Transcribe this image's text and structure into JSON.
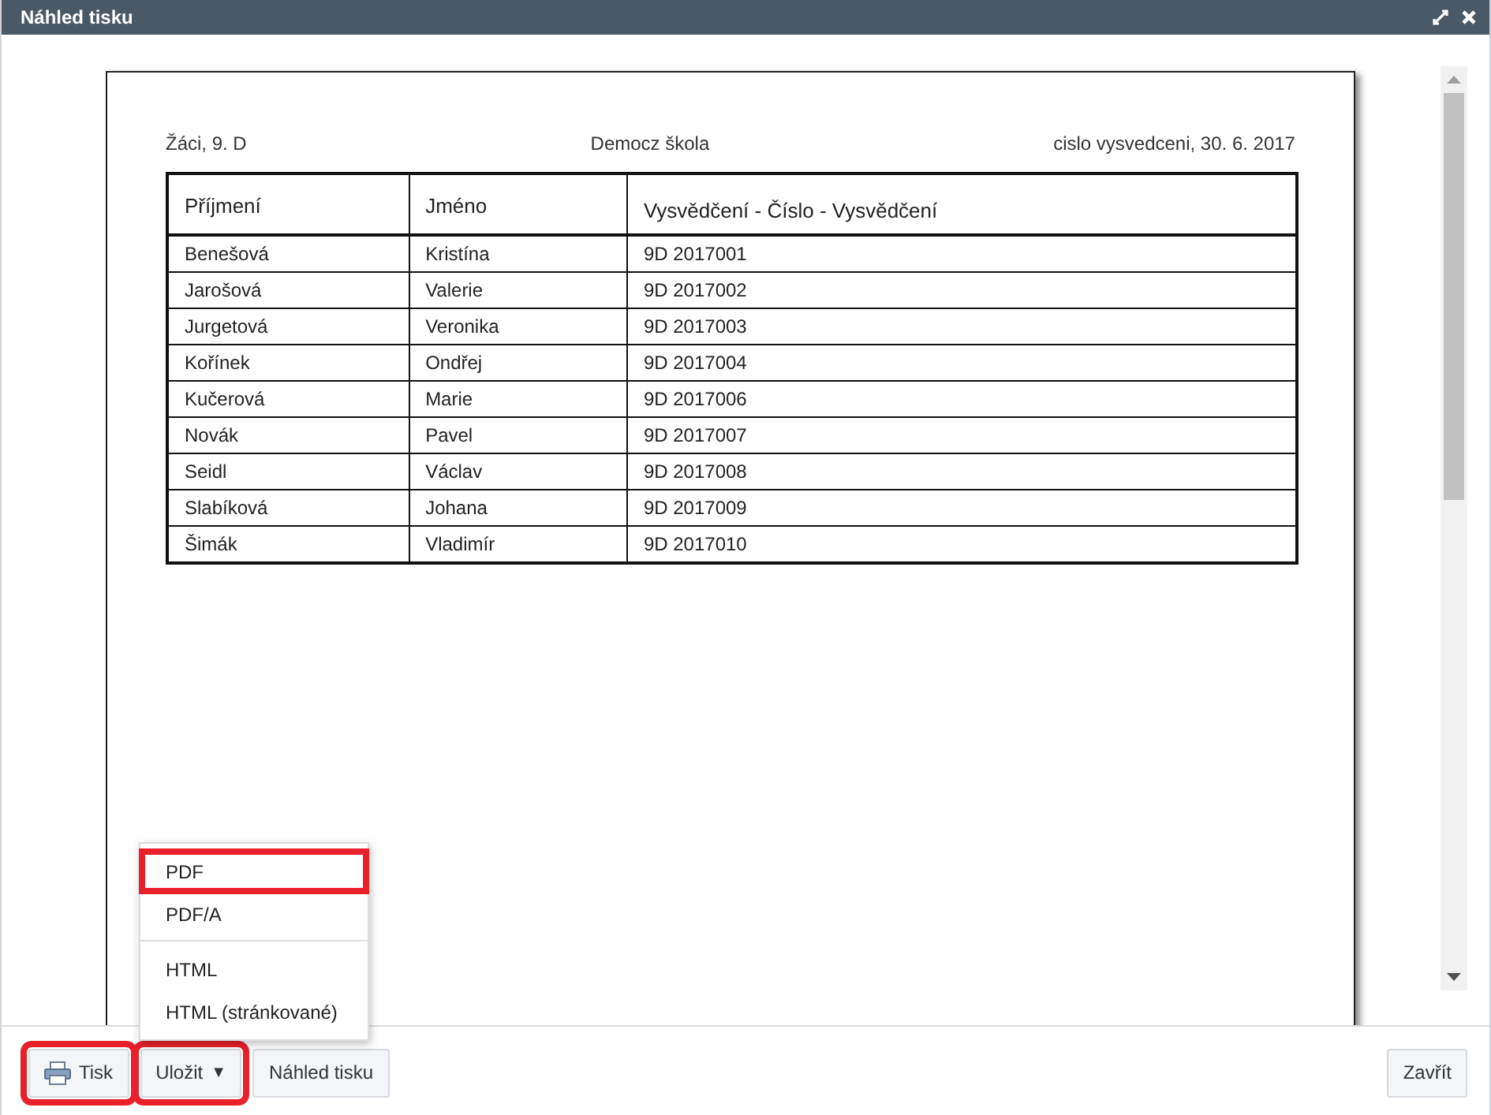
{
  "window": {
    "title": "Náhled tisku"
  },
  "page": {
    "header_left": "Žáci, 9. D",
    "header_center": "Democz škola",
    "header_right": "cislo vysvedceni, 30. 6. 2017"
  },
  "table": {
    "columns": [
      "Příjmení",
      "Jméno",
      "Vysvědčení - Číslo - Vysvědčení"
    ],
    "rows": [
      [
        "Benešová",
        "Kristína",
        "9D 2017001"
      ],
      [
        "Jarošová",
        "Valerie",
        "9D 2017002"
      ],
      [
        "Jurgetová",
        "Veronika",
        "9D 2017003"
      ],
      [
        "Kořínek",
        "Ondřej",
        "9D 2017004"
      ],
      [
        "Kučerová",
        "Marie",
        "9D 2017006"
      ],
      [
        "Novák",
        "Pavel",
        "9D 2017007"
      ],
      [
        "Seidl",
        "Václav",
        "9D 2017008"
      ],
      [
        "Slabíková",
        "Johana",
        "9D 2017009"
      ],
      [
        "Šimák",
        "Vladimír",
        "9D 2017010"
      ]
    ]
  },
  "menu": {
    "items": [
      {
        "kind": "item",
        "label": "PDF",
        "highlighted": true
      },
      {
        "kind": "item",
        "label": "PDF/A",
        "highlighted": false
      },
      {
        "kind": "separator"
      },
      {
        "kind": "item",
        "label": "HTML",
        "highlighted": false
      },
      {
        "kind": "item",
        "label": "HTML (stránkované)",
        "highlighted": false
      }
    ]
  },
  "buttons": [
    {
      "kind": "print",
      "label": "Tisk",
      "highlighted": true
    },
    {
      "kind": "dropdown",
      "label": "Uložit",
      "caret": "▼",
      "highlighted": true,
      "expanded": true
    },
    {
      "kind": "plain",
      "label": "Náhled tisku",
      "highlighted": false
    }
  ],
  "close_button": {
    "label": "Zavřít"
  }
}
